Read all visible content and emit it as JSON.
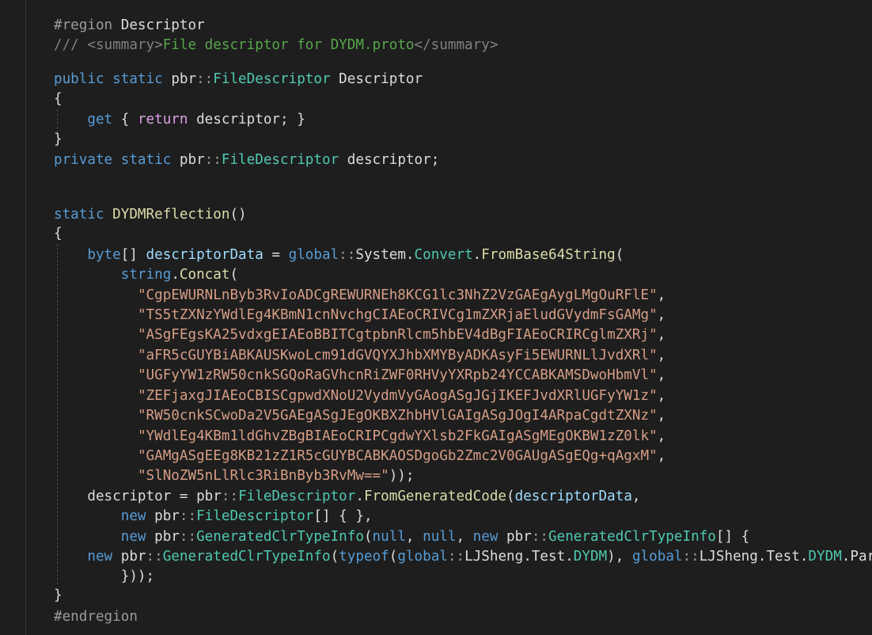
{
  "editor": {
    "region_directive": "#region",
    "region_name": "Descriptor",
    "doc_open": "/// ",
    "summary_open": "<summary>",
    "summary_text": "File descriptor for DYDM.proto",
    "summary_close": "</summary>",
    "kw_public": "public",
    "kw_private": "private",
    "kw_static": "static",
    "kw_get": "get",
    "kw_return": "return",
    "kw_byte": "byte",
    "kw_global": "global",
    "kw_string": "string",
    "kw_new": "new",
    "kw_null": "null",
    "kw_typeof": "typeof",
    "ns_pbr": "pbr",
    "ns_system": "System",
    "ns_ljsheng": "LJSheng",
    "ns_test": "Test",
    "type_file_descriptor": "FileDescriptor",
    "type_convert": "Convert",
    "type_generated": "GeneratedClrTypeInfo",
    "type_dydm": "DYDM",
    "prop_descriptor": "Descriptor",
    "field_descriptor": "descriptor",
    "ctor_name": "DYDMReflection",
    "var_descriptor_data": "descriptorData",
    "method_from_base64": "FromBase64String",
    "method_concat": "Concat",
    "method_from_generated": "FromGeneratedCode",
    "parser_text": "Parser",
    "base64_strings": [
      "CgpEWURNLnByb3RvIoADCgREWURNEh8KCG1lc3NhZ2VzGAEgAygLMgOuRFlE",
      "TS5tZXNzYWdlEg4KBmN1cnNvchgCIAEoCRIVCg1mZXRjaEludGVydmFsGAMg",
      "ASgFEgsKA25vdxgEIAEoBBITCgtpbnRlcm5hbEV4dBgFIAEoCRIRCglmZXRj",
      "aFR5cGUYBiABKAUSKwoLcm91dGVQYXJhbXMYByADKAsyFi5EWURNLlJvdXRl",
      "UGFyYW1zRW50cnkSGQoRaGVhcnRiZWF0RHVyYXRpb24YCCABKAMSDwoHbmVl",
      "ZEFjaxgJIAEoCBISCgpwdXNoU2VydmVyGAogASgJGjIKEFJvdXRlUGFyYW1z",
      "RW50cnkSCwoDa2V5GAEgASgJEgOKBXZhbHVlGAIgASgJOgI4ARpaCgdtZXNz",
      "YWdlEg4KBm1ldGhvZBgBIAEoCRIPCgdwYXlsb2FkGAIgASgMEgOKBW1zZ0lk",
      "GAMgASgEEg8KB21zZ1R5cGUYBCABKAOSDgoGb2Zmc2V0GAUgASgEQg+qAgxM",
      "SlNoZW5nLlRlc3RiBnByb3RvMw=="
    ],
    "endregion": "#endregion"
  }
}
